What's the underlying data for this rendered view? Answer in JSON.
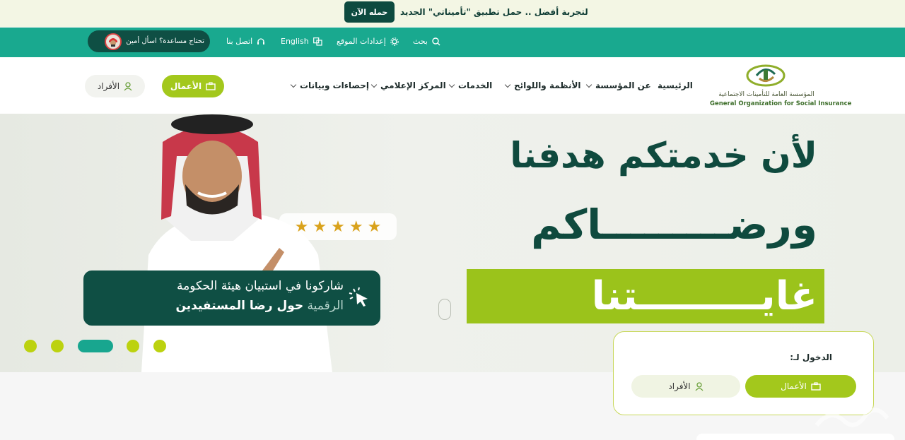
{
  "promo": {
    "text": "لتجربة أفضل .. حمل تطبيق \"تأميناتي\" الجديد",
    "button": "حمله الآن"
  },
  "utility": {
    "search": "بحث",
    "site_settings": "إعدادات الموقع",
    "language": "English",
    "contact": "اتصل بنا",
    "help": "تحتاج مساعدة؟ اسأل أمين"
  },
  "nav": {
    "items": [
      {
        "label": "الرئيسية",
        "dropdown": false
      },
      {
        "label": "عن المؤسسة",
        "dropdown": true
      },
      {
        "label": "الأنظمة واللوائح",
        "dropdown": true
      },
      {
        "label": "الخدمات",
        "dropdown": true
      },
      {
        "label": "المركز الإعلامي",
        "dropdown": true
      },
      {
        "label": "إحصاءات وبيانات",
        "dropdown": true
      }
    ],
    "business_button": "الأعمال",
    "individuals_button": "الأفراد"
  },
  "logo": {
    "arabic": "المؤسسة العامة للتأمينات الاجتماعية",
    "english": "General Organization for Social Insurance"
  },
  "hero": {
    "line1": "لأن خدمتكم هدفنا",
    "line2": "ورضـــــــــاكم",
    "line3": "غايـــــــــتنا",
    "rating_stars": 5,
    "survey_line1": "شاركونا في استبيان هيئة الحكومة",
    "survey_line2_light": "الرقمية",
    "survey_line2_bold": "حول رضا المستفيدين",
    "carousel_slides": 5,
    "carousel_active_index": 2
  },
  "login_card": {
    "title": "الدخول لـ:",
    "business_button": "الأعمال",
    "individuals_button": "الأفراد"
  },
  "colors": {
    "primary_teal": "#19a98f",
    "dark_green": "#0f4f44",
    "lime": "#a3c81c",
    "star": "#d9a21b"
  }
}
